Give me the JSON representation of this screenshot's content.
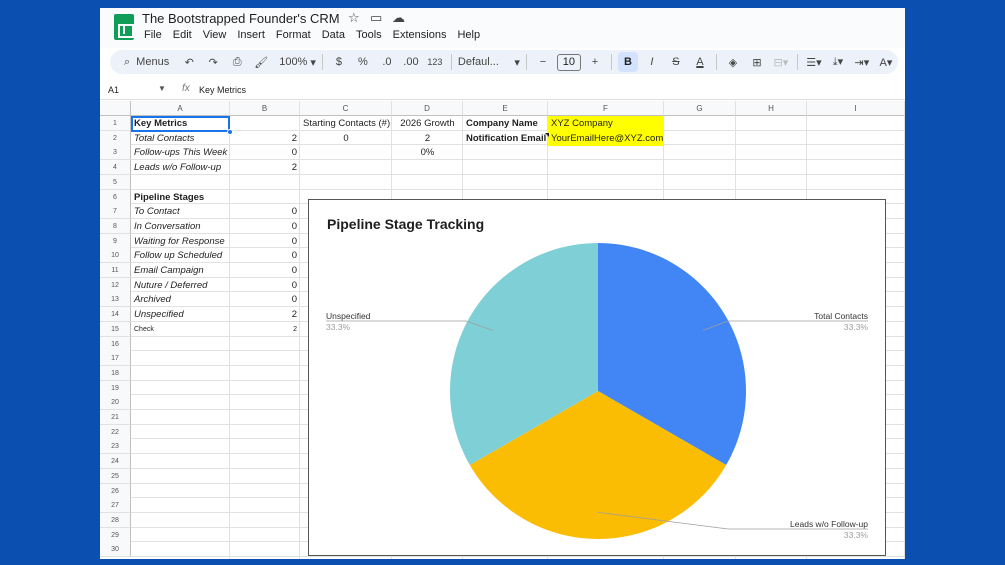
{
  "window": {
    "title": "The Bootstrapped Founder's CRM",
    "menu": [
      "File",
      "Edit",
      "View",
      "Insert",
      "Format",
      "Data",
      "Tools",
      "Extensions",
      "Help"
    ]
  },
  "toolbar": {
    "menus_label": "Menus",
    "zoom": "100%",
    "currency": "$",
    "percent": "%",
    "decrease_decimal": ".0",
    "increase_decimal": ".00",
    "number_format": "123",
    "font": "Defaul...",
    "font_size": "10",
    "minus": "−",
    "plus": "+",
    "bold": "B",
    "italic": "I",
    "strike": "S",
    "text_color": "A"
  },
  "formula_bar": {
    "cell_ref": "A1",
    "fx": "fx",
    "value": "Key Metrics"
  },
  "columns": [
    "A",
    "B",
    "C",
    "D",
    "E",
    "F",
    "G",
    "H",
    "I"
  ],
  "rows": [
    "1",
    "2",
    "3",
    "4",
    "5",
    "6",
    "7",
    "8",
    "9",
    "10",
    "11",
    "12",
    "13",
    "14",
    "15",
    "16",
    "17",
    "18",
    "19",
    "20",
    "21",
    "22",
    "23",
    "24",
    "25",
    "26",
    "27",
    "28",
    "29",
    "30"
  ],
  "cells": {
    "a1": "Key Metrics",
    "a2": "Total Contacts",
    "b2": "2",
    "a3": "Follow-ups This Week",
    "b3": "0",
    "a4": "Leads w/o Follow-up",
    "b4": "2",
    "c1": "Starting Contacts (#)",
    "c2": "0",
    "d1": "2026 Growth",
    "d2": "2",
    "d3": "0%",
    "e1": "Company Name",
    "f1": "XYZ Company",
    "e2": "Notification Email",
    "f2": "YourEmailHere@XYZ.com",
    "a6": "Pipeline Stages",
    "a7": "To Contact",
    "b7": "0",
    "a8": "In Conversation",
    "b8": "0",
    "a9": "Waiting for Response",
    "b9": "0",
    "a10": "Follow up Scheduled",
    "b10": "0",
    "a11": "Email Campaign",
    "b11": "0",
    "a12": "Nuture / Deferred",
    "b12": "0",
    "a13": "Archived",
    "b13": "0",
    "a14": "Unspecified",
    "b14": "2",
    "a15": "Check",
    "b15": "2"
  },
  "colors": {
    "highlight": "#ffff00",
    "selection": "#1a73e8"
  },
  "chart_data": {
    "type": "pie",
    "title": "Pipeline Stage Tracking",
    "slices": [
      {
        "label": "Total Contacts",
        "value": 33.3,
        "percent_label": "33.3%",
        "color": "#4285f4"
      },
      {
        "label": "Leads w/o Follow-up",
        "value": 33.3,
        "percent_label": "33.3%",
        "color": "#fbbc04"
      },
      {
        "label": "Unspecified",
        "value": 33.3,
        "percent_label": "33.3%",
        "color": "#7ed0d6"
      }
    ]
  }
}
